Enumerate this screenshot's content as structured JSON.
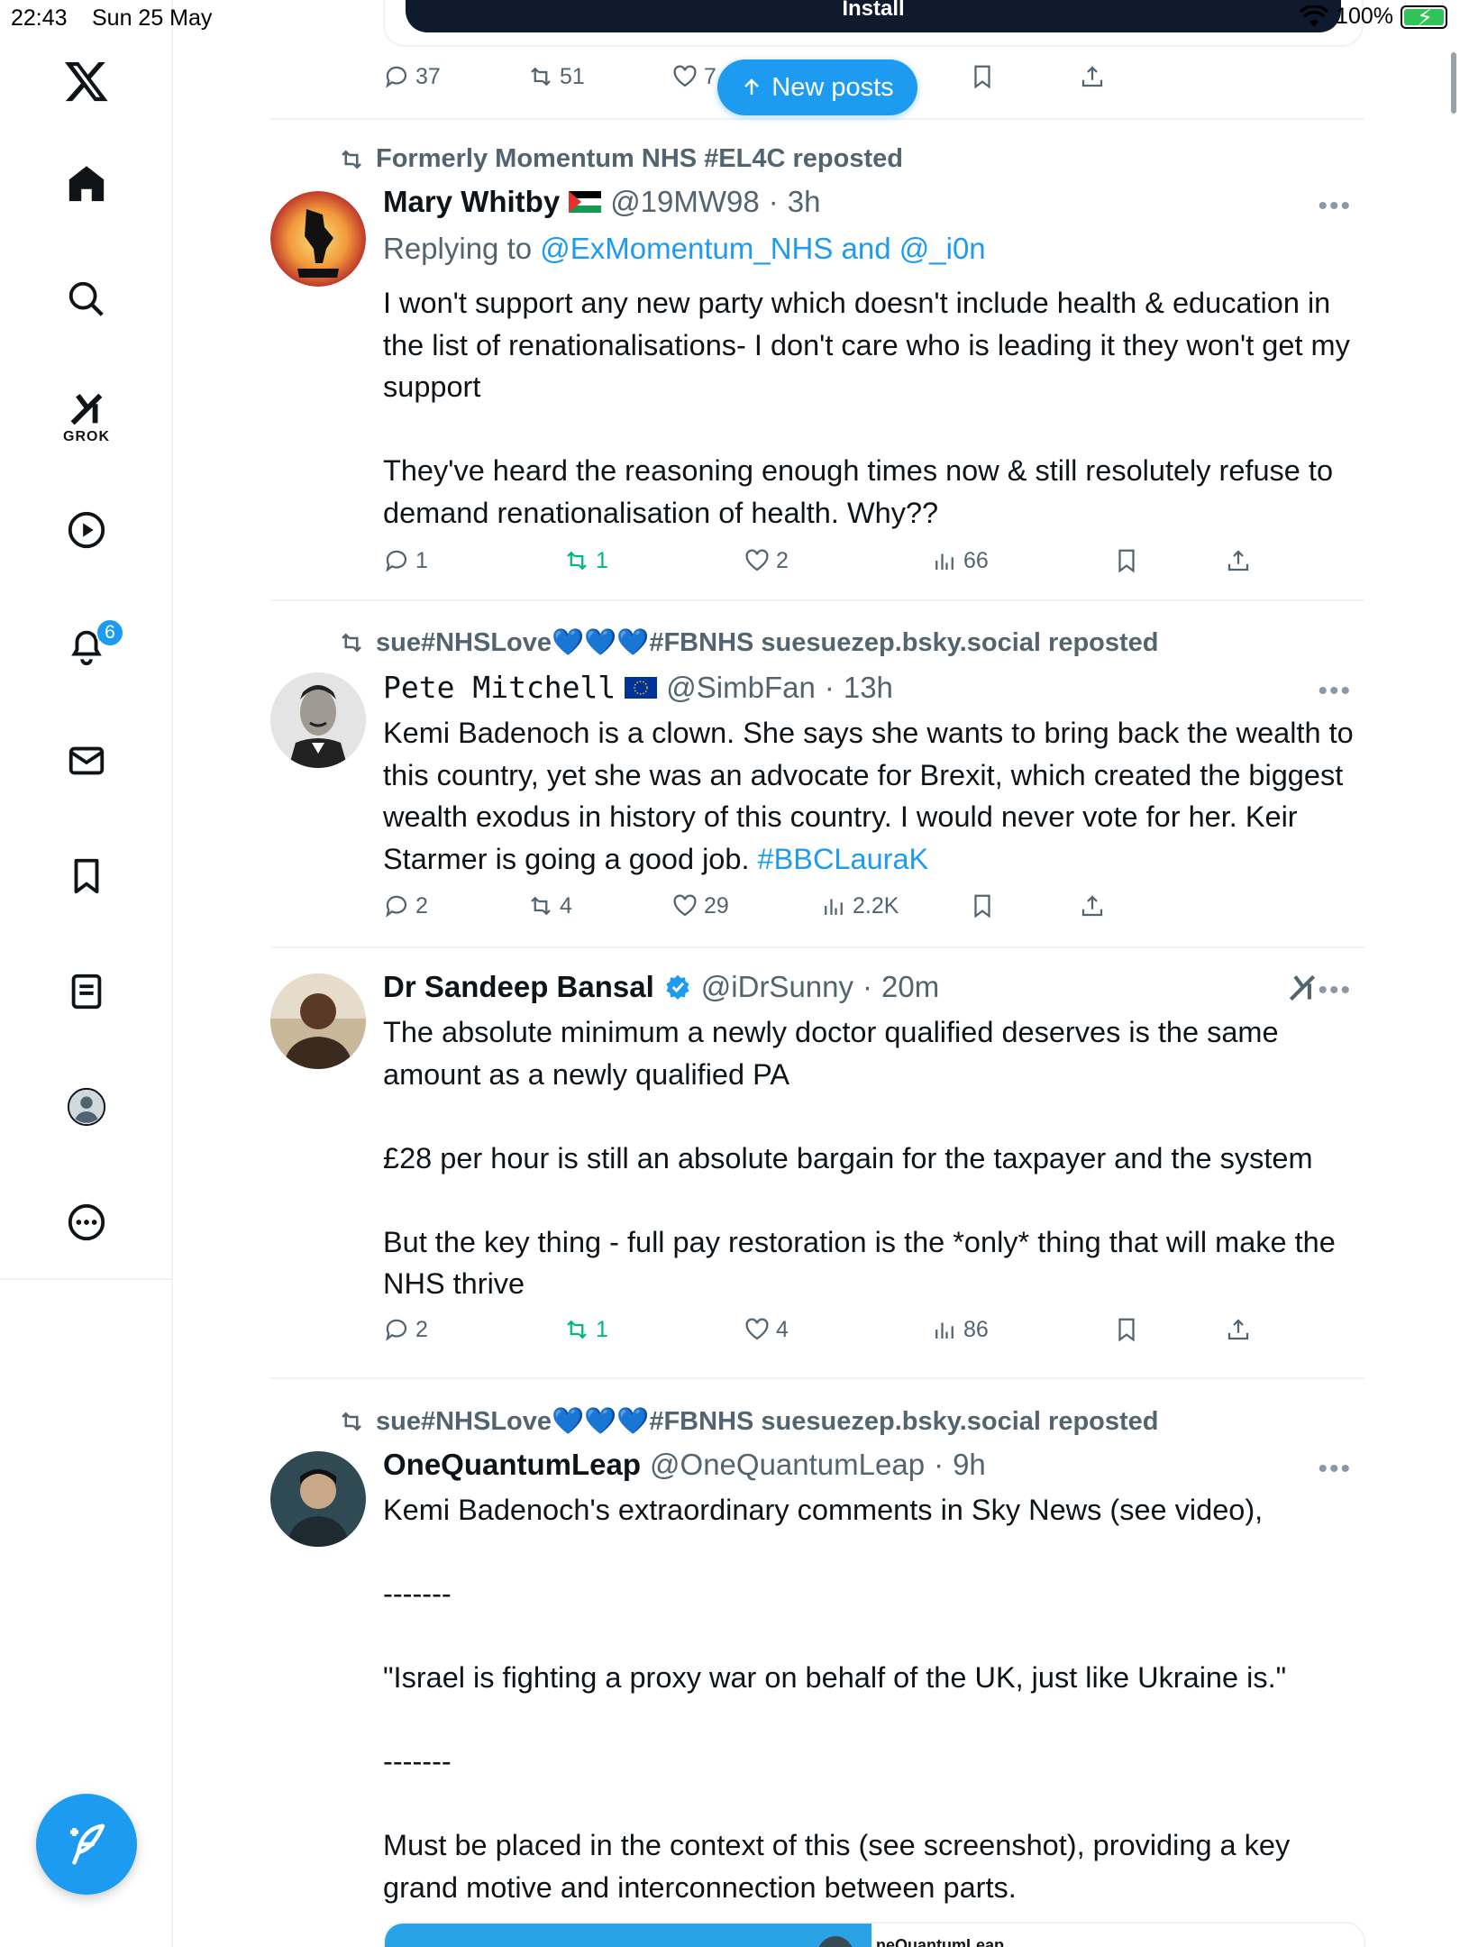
{
  "status_bar": {
    "time": "22:43",
    "date": "Sun 25 May",
    "battery": "100%"
  },
  "sidebar": {
    "items": [
      {
        "name": "x-logo"
      },
      {
        "name": "home"
      },
      {
        "name": "explore"
      },
      {
        "name": "grok",
        "label": "GROK"
      },
      {
        "name": "video"
      },
      {
        "name": "notifications",
        "badge": "6"
      },
      {
        "name": "messages"
      },
      {
        "name": "bookmarks"
      },
      {
        "name": "lists"
      },
      {
        "name": "profile"
      },
      {
        "name": "more"
      }
    ]
  },
  "install_banner": {
    "label": "Install"
  },
  "new_posts": {
    "label": "New posts"
  },
  "top_actions": {
    "replies": "37",
    "reposts": "51",
    "likes": "7"
  },
  "posts": [
    {
      "reposted_by": "Formerly Momentum NHS #EL4C reposted",
      "name": "Mary Whitby",
      "handle": "@19MW98",
      "time": "3h",
      "replying_prefix": "Replying to",
      "replying_to": "@ExMomentum_NHS and @_i0n",
      "text": "I won't support any new party which doesn't include health & education in the list of renationalisations- I don't care who is leading it they won't get my support\n\nThey've heard the reasoning enough times now & still resolutely refuse to demand renationalisation of health. Why??",
      "replies": "1",
      "reposts": "1",
      "likes": "2",
      "views": "66"
    },
    {
      "reposted_by": "sue#NHSLove💙💙💙#FBNHS suesuezep.bsky.social reposted",
      "name": "Pete Mitchell",
      "handle": "@SimbFan",
      "time": "13h",
      "text": "Kemi Badenoch is a clown. She says she wants to bring back the wealth to this country, yet she was an advocate for Brexit, which created the biggest wealth exodus in history of this country. I would never vote for her. Keir Starmer is going a good job. ",
      "hashtag": "#BBCLauraK",
      "replies": "2",
      "reposts": "4",
      "likes": "29",
      "views": "2.2K"
    },
    {
      "name": "Dr Sandeep Bansal",
      "handle": "@iDrSunny",
      "time": "20m",
      "text": "The absolute minimum a newly doctor qualified deserves is the same amount as a newly qualified PA\n\n£28 per hour is still an absolute bargain for the taxpayer and the system\n\nBut the key thing - full pay restoration is the *only* thing that will make the NHS thrive",
      "replies": "2",
      "reposts": "1",
      "likes": "4",
      "views": "86"
    },
    {
      "reposted_by": "sue#NHSLove💙💙💙#FBNHS suesuezep.bsky.social reposted",
      "name": "OneQuantumLeap",
      "handle": "@OneQuantumLeap",
      "time": "9h",
      "text": "Kemi Badenoch's extraordinary comments in Sky News (see video),\n\n-------\n\n\"Israel is fighting a proxy war on behalf of the UK, just like Ukraine is.\"\n\n-------\n\nMust be placed in the context of this (see screenshot), providing a key grand motive and interconnection between parts.",
      "media_label": "neQuantumLeap"
    }
  ],
  "separator": "·",
  "colors": {
    "accent": "#1d9bf0",
    "muted": "#536471",
    "repost_active": "#00ba7c",
    "text": "#0f1419"
  }
}
